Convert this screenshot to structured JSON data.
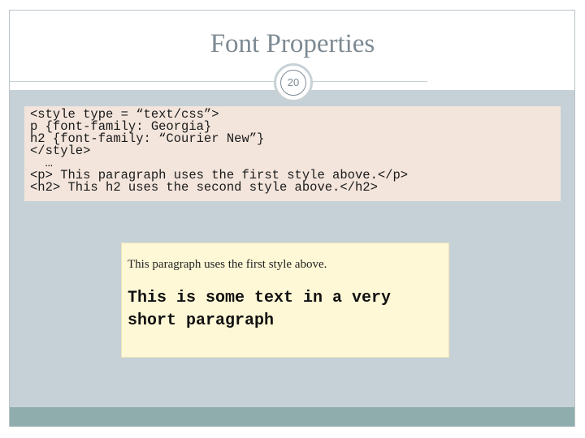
{
  "slide": {
    "title": "Font Properties",
    "number": "20"
  },
  "code": {
    "lines": [
      "<style type = “text/css”>",
      "p {font-family: Georgia}",
      "h2 {font-family: “Courier New”}",
      "</style>",
      "  …",
      "<p> This paragraph uses the first style above.</p>",
      "<h2> This h2 uses the second style above.</h2>"
    ]
  },
  "preview": {
    "paragraph": "This paragraph uses the first style above.",
    "heading": "This is some text in a very short paragraph"
  },
  "colors": {
    "panel": "#c6d1d7",
    "code_background": "#f3e5dc",
    "preview_background": "#fff8d6",
    "footer": "#8fadad"
  }
}
